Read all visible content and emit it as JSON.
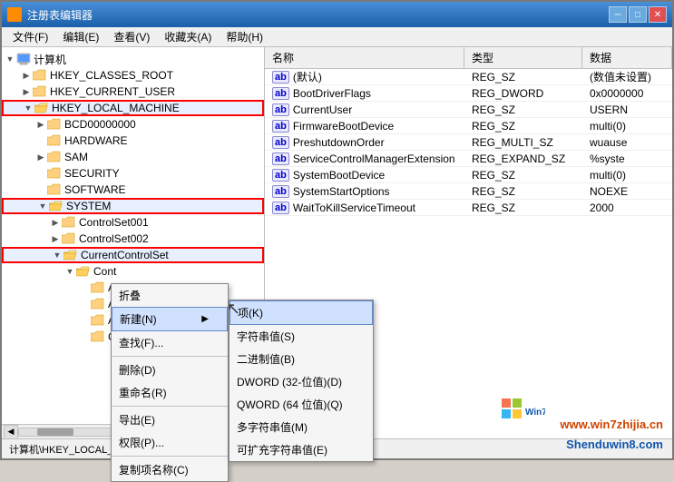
{
  "window": {
    "title": "注册表编辑器",
    "title_right_text": "文件(F)  编辑(E)  查看(V)  收藏夹(A)  帮助(H)"
  },
  "menu": {
    "items": [
      {
        "label": "文件(F)"
      },
      {
        "label": "编辑(E)"
      },
      {
        "label": "查看(V)"
      },
      {
        "label": "收藏夹(A)"
      },
      {
        "label": "帮助(H)"
      }
    ]
  },
  "tree": {
    "items": [
      {
        "id": "computer",
        "label": "计算机",
        "indent": 0,
        "expanded": true,
        "icon": "computer"
      },
      {
        "id": "hkey_classes",
        "label": "HKEY_CLASSES_ROOT",
        "indent": 1,
        "expanded": false
      },
      {
        "id": "hkey_current",
        "label": "HKEY_CURRENT_USER",
        "indent": 1,
        "expanded": false
      },
      {
        "id": "hkey_local",
        "label": "HKEY_LOCAL_MACHINE",
        "indent": 1,
        "expanded": true,
        "highlight": true
      },
      {
        "id": "bcd",
        "label": "BCD00000000",
        "indent": 2,
        "expanded": false
      },
      {
        "id": "hardware",
        "label": "HARDWARE",
        "indent": 2,
        "expanded": false
      },
      {
        "id": "sam",
        "label": "SAM",
        "indent": 2,
        "expanded": false
      },
      {
        "id": "security",
        "label": "SECURITY",
        "indent": 2,
        "expanded": false
      },
      {
        "id": "software",
        "label": "SOFTWARE",
        "indent": 2,
        "expanded": false
      },
      {
        "id": "system",
        "label": "SYSTEM",
        "indent": 2,
        "expanded": true,
        "highlight": true
      },
      {
        "id": "controlset001",
        "label": "ControlSet001",
        "indent": 3,
        "expanded": false
      },
      {
        "id": "controlset002",
        "label": "ControlSet002",
        "indent": 3,
        "expanded": false
      },
      {
        "id": "currentcontrolset",
        "label": "CurrentControlSet",
        "indent": 3,
        "expanded": true,
        "highlight": true
      },
      {
        "id": "cont",
        "label": "Cont",
        "indent": 4,
        "expanded": true
      },
      {
        "id": "a1",
        "label": "A",
        "indent": 5
      },
      {
        "id": "a2",
        "label": "A",
        "indent": 5
      },
      {
        "id": "a3",
        "label": "A",
        "indent": 5
      },
      {
        "id": "c1",
        "label": "C",
        "indent": 5
      }
    ]
  },
  "table": {
    "headers": [
      {
        "id": "name",
        "label": "名称"
      },
      {
        "id": "type",
        "label": "类型"
      },
      {
        "id": "data",
        "label": "数据"
      }
    ],
    "rows": [
      {
        "name": "ab(默认)",
        "type": "REG_SZ",
        "data": "(数值未设置)"
      },
      {
        "name": "ab BootDriverFlags",
        "type": "REG_DWORD",
        "data": "0x0000000"
      },
      {
        "name": "ab CurrentUser",
        "type": "REG_SZ",
        "data": "USERN"
      },
      {
        "name": "ab FirmwareBootDevice",
        "type": "REG_SZ",
        "data": "multi(0)"
      },
      {
        "name": "ab PreshutdownOrder",
        "type": "REG_MULTI_SZ",
        "data": "wuause"
      },
      {
        "name": "ab ServiceControlManagerExtension",
        "type": "REG_EXPAND_SZ",
        "data": "%syste"
      },
      {
        "name": "ab SystemBootDevice",
        "type": "REG_SZ",
        "data": "multi(0)"
      },
      {
        "name": "ab SystemStartOptions",
        "type": "REG_SZ",
        "data": "NOEXE"
      },
      {
        "name": "ab WaitToKillServiceTimeout",
        "type": "REG_SZ",
        "data": "2000"
      }
    ]
  },
  "context_menu": {
    "items": [
      {
        "label": "折叠",
        "id": "collapse"
      },
      {
        "label": "新建(N)",
        "id": "new",
        "has_submenu": true,
        "highlight": true
      },
      {
        "label": "查找(F)...",
        "id": "find"
      },
      {
        "label": "删除(D)",
        "id": "delete"
      },
      {
        "label": "重命名(R)",
        "id": "rename"
      },
      {
        "label": "导出(E)",
        "id": "export"
      },
      {
        "label": "权限(P)...",
        "id": "permissions"
      },
      {
        "label": "复制项名称(C)",
        "id": "copy"
      }
    ],
    "submenu": {
      "items": [
        {
          "label": "项(K)",
          "id": "key",
          "highlight": true
        },
        {
          "label": "字符串值(S)",
          "id": "string"
        },
        {
          "label": "二进制值(B)",
          "id": "binary"
        },
        {
          "label": "DWORD (32-位值)(D)",
          "id": "dword"
        },
        {
          "label": "QWORD (64 位值)(Q)",
          "id": "qword"
        },
        {
          "label": "多字符串值(M)",
          "id": "multi_string"
        },
        {
          "label": "可扩充字符串值(E)",
          "id": "expand_string"
        }
      ]
    }
  },
  "status_bar": {
    "text": "计算机\\HKEY_LOCAL_MAC"
  },
  "watermarks": {
    "wm1": "www.win7zhijia.cn",
    "wm2": "Shenduwin8.com"
  }
}
